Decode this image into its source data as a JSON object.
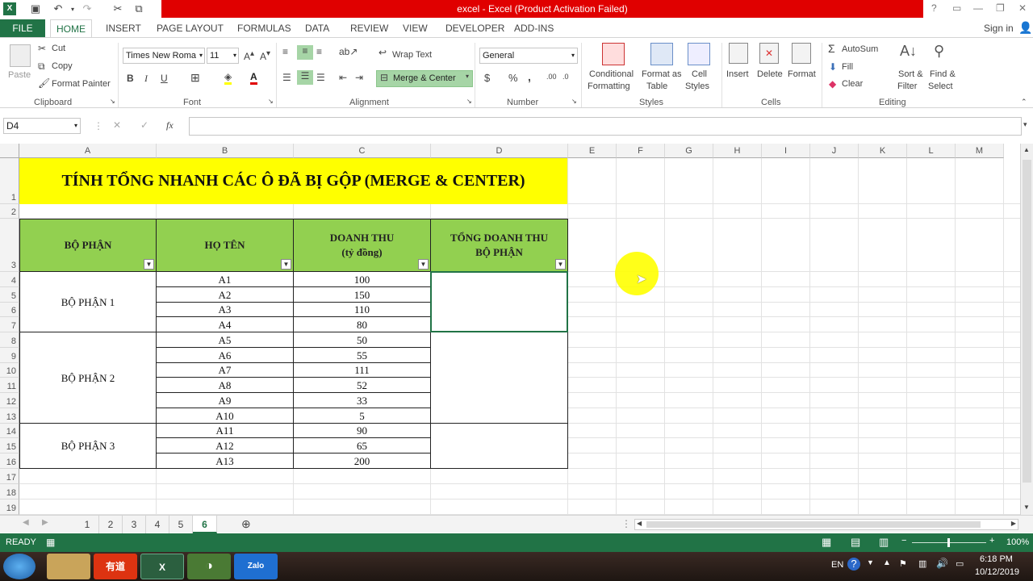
{
  "window": {
    "title": "excel -  Excel (Product Activation Failed)"
  },
  "quick_access": {
    "excel_icon": "excel-icon",
    "save": "save-icon",
    "undo": "undo-icon",
    "redo": "redo-icon"
  },
  "window_controls": {
    "help": "?",
    "min": "—",
    "restore": "❐",
    "close": "✕"
  },
  "tabs": {
    "file": "FILE",
    "home": "HOME",
    "insert": "INSERT",
    "page_layout": "PAGE LAYOUT",
    "formulas": "FORMULAS",
    "data": "DATA",
    "review": "REVIEW",
    "view": "VIEW",
    "developer": "DEVELOPER",
    "add_ins": "ADD-INS",
    "sign_in": "Sign in"
  },
  "ribbon": {
    "clipboard": {
      "group": "Clipboard",
      "paste": "Paste",
      "cut": "Cut",
      "copy": "Copy",
      "format_painter": "Format Painter"
    },
    "font": {
      "group": "Font",
      "name": "Times New Roma",
      "size": "11",
      "bold": "B",
      "italic": "I",
      "underline": "U"
    },
    "alignment": {
      "group": "Alignment",
      "wrap_text": "Wrap Text",
      "merge_center": "Merge & Center"
    },
    "number": {
      "group": "Number",
      "format": "General",
      "currency": "$",
      "percent": "%",
      "comma": ","
    },
    "styles": {
      "group": "Styles",
      "conditional_1": "Conditional",
      "conditional_2": "Formatting",
      "format_table_1": "Format as",
      "format_table_2": "Table",
      "cell_styles_1": "Cell",
      "cell_styles_2": "Styles"
    },
    "cells": {
      "group": "Cells",
      "insert": "Insert",
      "delete": "Delete",
      "format": "Format"
    },
    "editing": {
      "group": "Editing",
      "autosum": "AutoSum",
      "fill": "Fill",
      "clear": "Clear",
      "sort_1": "Sort &",
      "sort_2": "Filter",
      "find_1": "Find &",
      "find_2": "Select"
    }
  },
  "formula_bar": {
    "name_box": "D4",
    "fx": "fx",
    "content": ""
  },
  "columns": [
    "A",
    "B",
    "C",
    "D",
    "E",
    "F",
    "G",
    "H",
    "I",
    "J",
    "K",
    "L",
    "M"
  ],
  "rows": [
    "1",
    "2",
    "3",
    "4",
    "5",
    "6",
    "7",
    "8",
    "9",
    "10",
    "11",
    "12",
    "13",
    "14",
    "15",
    "16",
    "17",
    "18",
    "19"
  ],
  "sheet": {
    "title": "TÍNH TỔNG NHANH CÁC Ô ĐÃ BỊ GỘP (MERGE & CENTER)",
    "headers": {
      "bo_phan": "BỘ PHẬN",
      "ho_ten": "HỌ TÊN",
      "doanh_thu_1": "DOANH THU",
      "doanh_thu_2": "(tỷ đồng)",
      "tong_1": "TỔNG DOANH THU",
      "tong_2": "BỘ PHẬN"
    },
    "groups": [
      "BỘ PHẬN 1",
      "BỘ PHẬN 2",
      "BỘ PHẬN 3"
    ],
    "names": [
      "A1",
      "A2",
      "A3",
      "A4",
      "A5",
      "A6",
      "A7",
      "A8",
      "A9",
      "A10",
      "A11",
      "A12",
      "A13"
    ],
    "revenue": [
      "100",
      "150",
      "110",
      "80",
      "50",
      "55",
      "111",
      "52",
      "33",
      "5",
      "90",
      "65",
      "200"
    ]
  },
  "sheet_tabs": [
    "1",
    "2",
    "3",
    "4",
    "5",
    "6"
  ],
  "active_sheet": "6",
  "status": {
    "ready": "READY",
    "zoom": "100%"
  },
  "taskbar": {
    "lang": "EN",
    "time": "6:18 PM",
    "date": "10/12/2019"
  },
  "colors": {
    "excel_green": "#217346",
    "title_fill": "#ffff00",
    "header_fill": "#92d050",
    "activation_red": "#e00000"
  }
}
